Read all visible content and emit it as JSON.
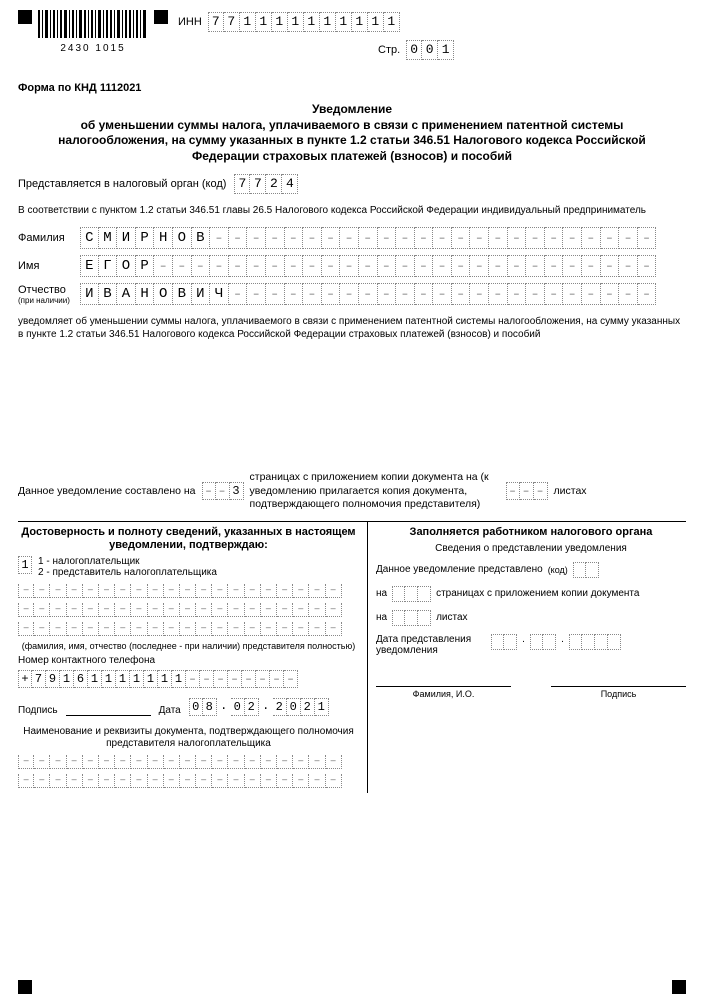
{
  "header": {
    "barcode_number": "2430  1015",
    "inn_label": "ИНН",
    "inn": [
      "7",
      "7",
      "1",
      "1",
      "1",
      "1",
      "1",
      "1",
      "1",
      "1",
      "1",
      "1"
    ],
    "page_label": "Стр.",
    "page": [
      "0",
      "0",
      "1"
    ]
  },
  "form_code": "Форма по КНД 1112021",
  "title_lines": [
    "Уведомление",
    "об уменьшении суммы налога, уплачиваемого в связи с применением патентной системы",
    "налогообложения, на сумму указанных в пункте 1.2 статьи 346.51 Налогового кодекса Российской",
    "Федерации страховых платежей (взносов) и пособий"
  ],
  "tax_authority": {
    "label": "Представляется в налоговый орган (код)",
    "code": [
      "7",
      "7",
      "2",
      "4"
    ]
  },
  "legal_basis": "В соответствии с пунктом 1.2 статьи 346.51 главы 26.5 Налогового кодекса Российской Федерации индивидуальный предприниматель",
  "fio": {
    "lastname_label": "Фамилия",
    "lastname": "СМИРНОВ",
    "firstname_label": "Имя",
    "firstname": "ЕГОР",
    "middlename_label": "Отчество",
    "middlename_hint": "(при наличии)",
    "middlename": "ИВАНОВИЧ",
    "width": 31
  },
  "notify_text": "уведомляет об уменьшении суммы налога, уплачиваемого в связи с применением патентной системы налогообложения, на сумму указанных в пункте 1.2 статьи 346.51 Налогового кодекса Российской Федерации страховых платежей (взносов) и пособий",
  "page_count": {
    "prefix": "Данное уведомление составлено на",
    "pages": [
      "–",
      "–",
      "3"
    ],
    "middle": "страницах с приложением копии документа на (к уведомлению прилагается копия документа, подтверждающего полномочия представителя)",
    "attach": [
      "–",
      "–",
      "–"
    ],
    "suffix": "листах"
  },
  "left_col": {
    "heading": "Достоверность и полноту сведений, указанных в настоящем уведомлении, подтверждаю:",
    "signer_code": "1",
    "signer_options": "1 - налогоплательщик\n2 - представитель налогоплательщика",
    "rep_hint": "(фамилия, имя, отчество (последнее - при наличии) представителя полностью)",
    "phone_label": "Номер контактного телефона",
    "phone": [
      "+",
      "7",
      "9",
      "1",
      "6",
      "1",
      "1",
      "1",
      "1",
      "1",
      "1",
      "1",
      "–",
      "–",
      "–",
      "–",
      "–",
      "–",
      "–",
      "–"
    ],
    "sign_label": "Подпись",
    "date_label": "Дата",
    "date": [
      "0",
      "8",
      ".",
      "0",
      "2",
      ".",
      "2",
      "0",
      "2",
      "1"
    ],
    "doc_name_heading": "Наименование и реквизиты документа, подтверждающего полномочия представителя налогоплательщика"
  },
  "right_col": {
    "heading": "Заполняется работником налогового органа",
    "sub": "Сведения о представлении уведомления",
    "presented": "Данное уведомление представлено",
    "code": "(код)",
    "on": "на",
    "pages_text": "страницах с приложением копии документа",
    "sheets": "листах",
    "date_label": "Дата представления уведомления",
    "fio_sig": "Фамилия, И.О.",
    "sign": "Подпись"
  }
}
